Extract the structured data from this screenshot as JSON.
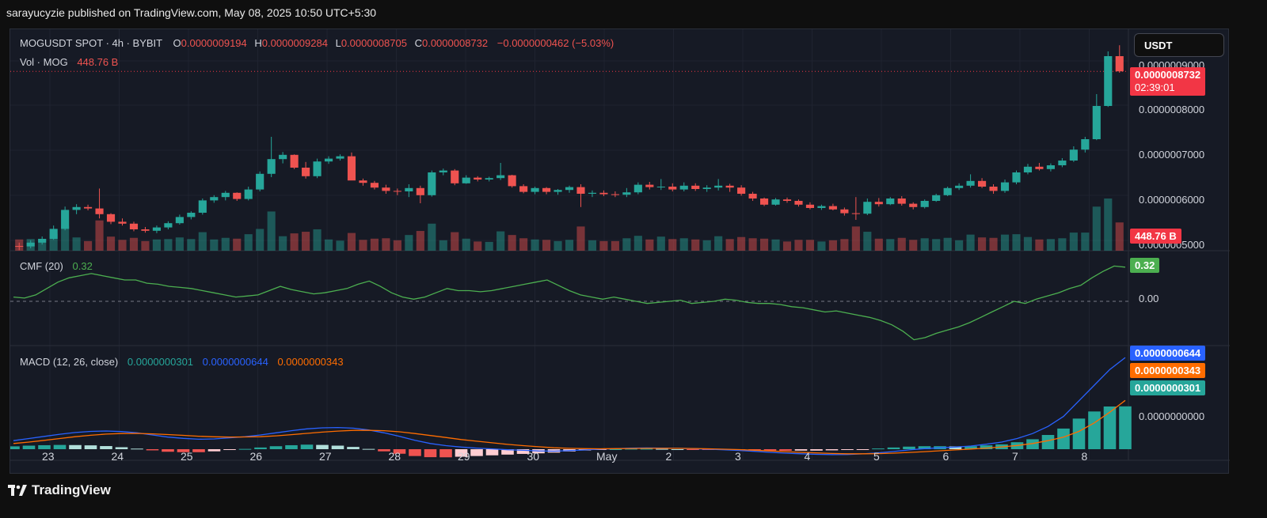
{
  "header": {
    "published": "sarayucyzie published on TradingView.com, May 08, 2025 10:50 UTC+5:30"
  },
  "legend": {
    "symbol": "MOGUSDT SPOT · 4h · BYBIT",
    "o_label": "O",
    "o": "0.0000009194",
    "h_label": "H",
    "h": "0.0000009284",
    "l_label": "L",
    "l": "0.0000008705",
    "c_label": "C",
    "c": "0.0000008732",
    "change": "−0.0000000462 (−5.03%)",
    "vol_label": "Vol · MOG",
    "vol_value": "448.76 B",
    "cmf_label": "CMF (20)",
    "cmf_value": "0.32",
    "macd_label": "MACD (12, 26, close)",
    "macd_hist": "0.0000000301",
    "macd_line": "0.0000000644",
    "macd_signal": "0.0000000343"
  },
  "currency_button": "USDT",
  "price_tags": {
    "last_price": "0.0000008732",
    "countdown": "02:39:01",
    "volume": "448.76 B",
    "cmf": "0.32",
    "macd": "0.0000000644",
    "signal": "0.0000000343",
    "hist": "0.0000000301"
  },
  "footer": {
    "brand": "TradingView",
    "logo_icon": "tradingview-logo-icon"
  },
  "colors": {
    "up": "#26a69a",
    "down": "#ef5350",
    "cmf": "#4caf50",
    "macd": "#2962ff",
    "signal": "#ff6d00",
    "hist_up": "#26a69a",
    "hist_down": "#ef5350"
  },
  "chart_data": [
    {
      "type": "candlestick",
      "title": "MOGUSDT SPOT · 4h · BYBIT",
      "x_labels": [
        "23",
        "24",
        "25",
        "26",
        "27",
        "28",
        "29",
        "30",
        "May",
        "2",
        "3",
        "4",
        "5",
        "6",
        "7",
        "8"
      ],
      "y_ticks": [
        "0.0000009000",
        "0.0000008000",
        "0.0000007000",
        "0.0000006000",
        "0.0000005000"
      ],
      "ylim": [
        4.95e-07,
        9.45e-07
      ],
      "ohlc": [
        [
          5.05e-07,
          5.12e-07,
          4.96e-07,
          5.04e-07
        ],
        [
          5.04e-07,
          5.17e-07,
          5e-07,
          5.12e-07
        ],
        [
          5.12e-07,
          5.25e-07,
          5.08e-07,
          5.2e-07
        ],
        [
          5.2e-07,
          5.48e-07,
          5.18e-07,
          5.41e-07
        ],
        [
          5.41e-07,
          5.88e-07,
          5.38e-07,
          5.81e-07
        ],
        [
          5.81e-07,
          5.93e-07,
          5.72e-07,
          5.87e-07
        ],
        [
          5.87e-07,
          5.92e-07,
          5.8e-07,
          5.84e-07
        ],
        [
          5.84e-07,
          6.26e-07,
          5.63e-07,
          5.72e-07
        ],
        [
          5.72e-07,
          5.74e-07,
          5.51e-07,
          5.56e-07
        ],
        [
          5.56e-07,
          5.63e-07,
          5.48e-07,
          5.52e-07
        ],
        [
          5.52e-07,
          5.56e-07,
          5.36e-07,
          5.4e-07
        ],
        [
          5.4e-07,
          5.45e-07,
          5.33e-07,
          5.37e-07
        ],
        [
          5.37e-07,
          5.48e-07,
          5.32e-07,
          5.44e-07
        ],
        [
          5.44e-07,
          5.57e-07,
          5.4e-07,
          5.53e-07
        ],
        [
          5.53e-07,
          5.71e-07,
          5.5e-07,
          5.66e-07
        ],
        [
          5.66e-07,
          5.78e-07,
          5.61e-07,
          5.75e-07
        ],
        [
          5.75e-07,
          6.05e-07,
          5.71e-07,
          6.01e-07
        ],
        [
          6.01e-07,
          6.12e-07,
          5.96e-07,
          6.08e-07
        ],
        [
          6.08e-07,
          6.21e-07,
          6.01e-07,
          6.17e-07
        ],
        [
          6.17e-07,
          6.18e-07,
          6e-07,
          6.04e-07
        ],
        [
          6.04e-07,
          6.3e-07,
          6.01e-07,
          6.24e-07
        ],
        [
          6.24e-07,
          6.62e-07,
          6.2e-07,
          6.57e-07
        ],
        [
          6.57e-07,
          7.35e-07,
          6.5e-07,
          6.88e-07
        ],
        [
          6.88e-07,
          7.03e-07,
          6.79e-07,
          6.97e-07
        ],
        [
          6.97e-07,
          6.98e-07,
          6.67e-07,
          6.7e-07
        ],
        [
          6.7e-07,
          6.82e-07,
          6.47e-07,
          6.52e-07
        ],
        [
          6.52e-07,
          6.89e-07,
          6.48e-07,
          6.83e-07
        ],
        [
          6.83e-07,
          6.94e-07,
          6.78e-07,
          6.89e-07
        ],
        [
          6.89e-07,
          6.98e-07,
          6.85e-07,
          6.94e-07
        ],
        [
          6.94e-07,
          7.02e-07,
          6.7e-07,
          6.43e-07
        ],
        [
          6.43e-07,
          6.47e-07,
          6.32e-07,
          6.38e-07
        ],
        [
          6.38e-07,
          6.42e-07,
          6.24e-07,
          6.28e-07
        ],
        [
          6.28e-07,
          6.34e-07,
          6.15e-07,
          6.21e-07
        ],
        [
          6.21e-07,
          6.26e-07,
          6.12e-07,
          6.2e-07
        ],
        [
          6.2e-07,
          6.35e-07,
          6.08e-07,
          6.27e-07
        ],
        [
          6.27e-07,
          6.32e-07,
          5.95e-07,
          6.12e-07
        ],
        [
          6.12e-07,
          6.64e-07,
          6.09e-07,
          6.6e-07
        ],
        [
          6.6e-07,
          6.68e-07,
          6.54e-07,
          6.64e-07
        ],
        [
          6.64e-07,
          6.67e-07,
          6.33e-07,
          6.37e-07
        ],
        [
          6.37e-07,
          6.54e-07,
          6.36e-07,
          6.49e-07
        ],
        [
          6.49e-07,
          6.52e-07,
          6.41e-07,
          6.45e-07
        ],
        [
          6.45e-07,
          6.51e-07,
          6.41e-07,
          6.48e-07
        ],
        [
          6.48e-07,
          6.8e-07,
          6.44e-07,
          6.54e-07
        ],
        [
          6.54e-07,
          6.55e-07,
          6.28e-07,
          6.31e-07
        ],
        [
          6.31e-07,
          6.35e-07,
          6.16e-07,
          6.19e-07
        ],
        [
          6.19e-07,
          6.3e-07,
          6.14e-07,
          6.27e-07
        ],
        [
          6.27e-07,
          6.29e-07,
          6.14e-07,
          6.19e-07
        ],
        [
          6.19e-07,
          6.25e-07,
          6.13e-07,
          6.23e-07
        ],
        [
          6.23e-07,
          6.32e-07,
          6.17e-07,
          6.29e-07
        ],
        [
          6.29e-07,
          6.35e-07,
          5.87e-07,
          6.15e-07
        ],
        [
          6.15e-07,
          6.22e-07,
          6.08e-07,
          6.17e-07
        ],
        [
          6.17e-07,
          6.22e-07,
          6.1e-07,
          6.14e-07
        ],
        [
          6.14e-07,
          6.2e-07,
          6.08e-07,
          6.13e-07
        ],
        [
          6.13e-07,
          6.27e-07,
          6.08e-07,
          6.18e-07
        ],
        [
          6.18e-07,
          6.39e-07,
          6.14e-07,
          6.34e-07
        ],
        [
          6.34e-07,
          6.4e-07,
          6.24e-07,
          6.29e-07
        ],
        [
          6.29e-07,
          6.46e-07,
          6.23e-07,
          6.3e-07
        ],
        [
          6.3e-07,
          6.37e-07,
          6.2e-07,
          6.24e-07
        ],
        [
          6.24e-07,
          6.39e-07,
          6.2e-07,
          6.32e-07
        ],
        [
          6.32e-07,
          6.37e-07,
          6.21e-07,
          6.25e-07
        ],
        [
          6.25e-07,
          6.33e-07,
          6.19e-07,
          6.28e-07
        ],
        [
          6.28e-07,
          6.46e-07,
          6.22e-07,
          6.32e-07
        ],
        [
          6.32e-07,
          6.36e-07,
          6.19e-07,
          6.28e-07
        ],
        [
          6.28e-07,
          6.33e-07,
          6.11e-07,
          6.15e-07
        ],
        [
          6.15e-07,
          6.19e-07,
          6e-07,
          6.05e-07
        ],
        [
          6.05e-07,
          6.07e-07,
          5.89e-07,
          5.92e-07
        ],
        [
          5.92e-07,
          6.06e-07,
          5.9e-07,
          6.03e-07
        ],
        [
          6.03e-07,
          6.07e-07,
          5.96e-07,
          6e-07
        ],
        [
          6e-07,
          6.03e-07,
          5.88e-07,
          5.92e-07
        ],
        [
          5.92e-07,
          5.97e-07,
          5.82e-07,
          5.85e-07
        ],
        [
          5.85e-07,
          5.92e-07,
          5.81e-07,
          5.89e-07
        ],
        [
          5.89e-07,
          5.94e-07,
          5.8e-07,
          5.82e-07
        ],
        [
          5.82e-07,
          5.86e-07,
          5.69e-07,
          5.74e-07
        ],
        [
          5.74e-07,
          6.08e-07,
          5.6e-07,
          5.73e-07
        ],
        [
          5.73e-07,
          6.05e-07,
          5.7e-07,
          5.98e-07
        ],
        [
          5.98e-07,
          6.06e-07,
          5.88e-07,
          5.93e-07
        ],
        [
          5.93e-07,
          6.08e-07,
          5.91e-07,
          6.05e-07
        ],
        [
          6.05e-07,
          6.1e-07,
          5.9e-07,
          5.94e-07
        ],
        [
          5.94e-07,
          5.97e-07,
          5.82e-07,
          5.87e-07
        ],
        [
          5.87e-07,
          6.03e-07,
          5.84e-07,
          6e-07
        ],
        [
          6e-07,
          6.15e-07,
          5.98e-07,
          6.12e-07
        ],
        [
          6.12e-07,
          6.3e-07,
          6.1e-07,
          6.27e-07
        ],
        [
          6.27e-07,
          6.37e-07,
          6.23e-07,
          6.32e-07
        ],
        [
          6.32e-07,
          6.56e-07,
          6.28e-07,
          6.42e-07
        ],
        [
          6.42e-07,
          6.48e-07,
          6.27e-07,
          6.3e-07
        ],
        [
          6.3e-07,
          6.35e-07,
          6.15e-07,
          6.21e-07
        ],
        [
          6.21e-07,
          6.45e-07,
          6.17e-07,
          6.39e-07
        ],
        [
          6.39e-07,
          6.64e-07,
          6.35e-07,
          6.6e-07
        ],
        [
          6.6e-07,
          6.78e-07,
          6.56e-07,
          6.72e-07
        ],
        [
          6.72e-07,
          6.8e-07,
          6.64e-07,
          6.67e-07
        ],
        [
          6.67e-07,
          6.79e-07,
          6.62e-07,
          6.75e-07
        ],
        [
          6.75e-07,
          6.9e-07,
          6.71e-07,
          6.85e-07
        ],
        [
          6.85e-07,
          7.15e-07,
          6.82e-07,
          7.08e-07
        ],
        [
          7.08e-07,
          7.35e-07,
          7.02e-07,
          7.3e-07
        ],
        [
          7.3e-07,
          8.25e-07,
          7.28e-07,
          8e-07
        ],
        [
          8e-07,
          9.15e-07,
          7.98e-07,
          9.05e-07
        ],
        [
          9.05e-07,
          9.28e-07,
          8.7e-07,
          8.73e-07
        ]
      ],
      "volume_max_label": "448.76 B"
    },
    {
      "type": "line",
      "title": "CMF (20)",
      "y_ticks": [
        "0.00"
      ],
      "series": [
        {
          "name": "CMF (20)",
          "values": [
            0.04,
            0.03,
            0.06,
            0.12,
            0.18,
            0.22,
            0.24,
            0.26,
            0.24,
            0.22,
            0.2,
            0.2,
            0.17,
            0.16,
            0.14,
            0.13,
            0.12,
            0.1,
            0.08,
            0.06,
            0.04,
            0.05,
            0.06,
            0.1,
            0.14,
            0.11,
            0.09,
            0.07,
            0.08,
            0.1,
            0.12,
            0.16,
            0.19,
            0.14,
            0.08,
            0.04,
            0.02,
            0.04,
            0.08,
            0.12,
            0.1,
            0.1,
            0.09,
            0.1,
            0.12,
            0.14,
            0.16,
            0.18,
            0.2,
            0.15,
            0.1,
            0.06,
            0.04,
            0.02,
            0.04,
            0.02,
            0.0,
            -0.02,
            -0.01,
            0.0,
            0.01,
            -0.02,
            -0.01,
            0.0,
            0.02,
            0.01,
            -0.01,
            -0.02,
            -0.02,
            -0.03,
            -0.05,
            -0.06,
            -0.08,
            -0.1,
            -0.09,
            -0.11,
            -0.13,
            -0.15,
            -0.18,
            -0.22,
            -0.28,
            -0.36,
            -0.34,
            -0.3,
            -0.27,
            -0.24,
            -0.2,
            -0.15,
            -0.1,
            -0.05,
            0.0,
            -0.02,
            0.02,
            0.05,
            0.08,
            0.12,
            0.15,
            0.22,
            0.28,
            0.33,
            0.32
          ]
        }
      ],
      "ylim": [
        -0.4,
        0.4
      ]
    },
    {
      "type": "line",
      "title": "MACD (12, 26, close)",
      "y_ticks": [
        "0.0000000000"
      ],
      "series": [
        {
          "name": "MACD",
          "values": [
            6e-09,
            7.5e-09,
            9e-09,
            1.05e-08,
            1.17e-08,
            1.25e-08,
            1.28e-08,
            1.24e-08,
            1.15e-08,
            1e-08,
            8.5e-09,
            7.6e-09,
            7e-09,
            7.2e-09,
            8e-09,
            8.8e-09,
            1e-08,
            1.15e-08,
            1.3e-08,
            1.43e-08,
            1.5e-08,
            1.52e-08,
            1.48e-08,
            1.35e-08,
            1.15e-08,
            9e-09,
            6.2e-09,
            4e-09,
            2.5e-09,
            1.5e-09,
            8e-10,
            2e-10,
            -4e-10,
            -8e-10,
            -1.2e-09,
            -1.4e-09,
            -1e-09,
            -5e-10,
            0.0,
            4e-10,
            8e-10,
            9e-10,
            8e-10,
            6e-10,
            4e-10,
            0.0,
            -4e-10,
            -9e-10,
            -1.5e-09,
            -2.2e-09,
            -2.8e-09,
            -3.2e-09,
            -3.6e-09,
            -3.8e-09,
            -3.7e-09,
            -3.3e-09,
            -2.6e-09,
            -1.6e-09,
            -5e-10,
            4e-10,
            1e-09,
            1.5e-09,
            2.2e-09,
            3.5e-09,
            5e-09,
            7.5e-09,
            1.1e-08,
            1.6e-08,
            2.3e-08,
            3.4e-08,
            4.5e-08,
            5.6e-08,
            6.44e-08
          ]
        },
        {
          "name": "Signal",
          "values": [
            4e-09,
            5e-09,
            6.2e-09,
            7.5e-09,
            8.8e-09,
            9.8e-09,
            1.06e-08,
            1.1e-08,
            1.11e-08,
            1.08e-08,
            1.03e-08,
            9.7e-09,
            9.1e-09,
            8.7e-09,
            8.5e-09,
            8.6e-09,
            8.8e-09,
            9.4e-09,
            1.02e-08,
            1.11e-08,
            1.2e-08,
            1.27e-08,
            1.32e-08,
            1.33e-08,
            1.3e-08,
            1.22e-08,
            1.1e-08,
            9.6e-09,
            8.2e-09,
            6.8e-09,
            5.6e-09,
            4.5e-09,
            3.4e-09,
            2.5e-09,
            1.7e-09,
            1e-09,
            6e-10,
            4e-10,
            3e-10,
            4e-10,
            5e-10,
            6e-10,
            6e-10,
            6e-10,
            5e-10,
            3e-10,
            0.0,
            -3e-10,
            -7e-10,
            -1.2e-09,
            -1.7e-09,
            -2.2e-09,
            -2.6e-09,
            -3e-09,
            -3.2e-09,
            -3.2e-09,
            -3.1e-09,
            -2.8e-09,
            -2.3e-09,
            -1.7e-09,
            -1.1e-09,
            -5e-10,
            1e-10,
            8e-10,
            1.6e-09,
            2.6e-09,
            4e-09,
            6e-09,
            8.5e-09,
            1.25e-08,
            1.85e-08,
            2.6e-08,
            3.43e-08
          ]
        }
      ],
      "ylim": [
        -5e-09,
        7e-08
      ]
    }
  ]
}
